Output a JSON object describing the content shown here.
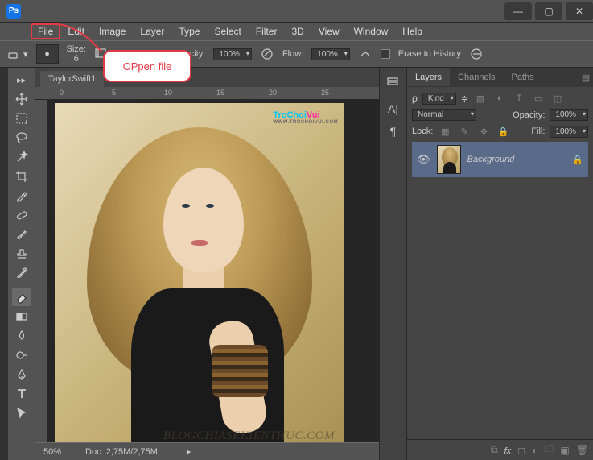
{
  "menu": [
    "File",
    "Edit",
    "Image",
    "Layer",
    "Type",
    "Select",
    "Filter",
    "3D",
    "View",
    "Window",
    "Help"
  ],
  "options": {
    "size_label": "Size:",
    "size_value": "6",
    "opacity_label": "Opacity:",
    "opacity_value": "100%",
    "flow_label": "Flow:",
    "flow_value": "100%",
    "erase_history": "Erase to History"
  },
  "tab": {
    "name": "TaylorSwift1"
  },
  "status": {
    "zoom": "50%",
    "doc": "Doc: 2,75M/2,75M"
  },
  "canvas": {
    "wm1_a": "TroChoi",
    "wm1_b": "Vui",
    "wm1_sub": "WWW.TROCHOIVUI.COM",
    "wm2": "BLOGCHIASEKIENTHUC.COM"
  },
  "layers_panel": {
    "tabs": [
      "Layers",
      "Channels",
      "Paths"
    ],
    "kind": "Kind",
    "blend": "Normal",
    "opacity_label": "Opacity:",
    "opacity_value": "100%",
    "lock_label": "Lock:",
    "fill_label": "Fill:",
    "fill_value": "100%",
    "layer_name": "Background"
  },
  "callout": "OPpen file"
}
